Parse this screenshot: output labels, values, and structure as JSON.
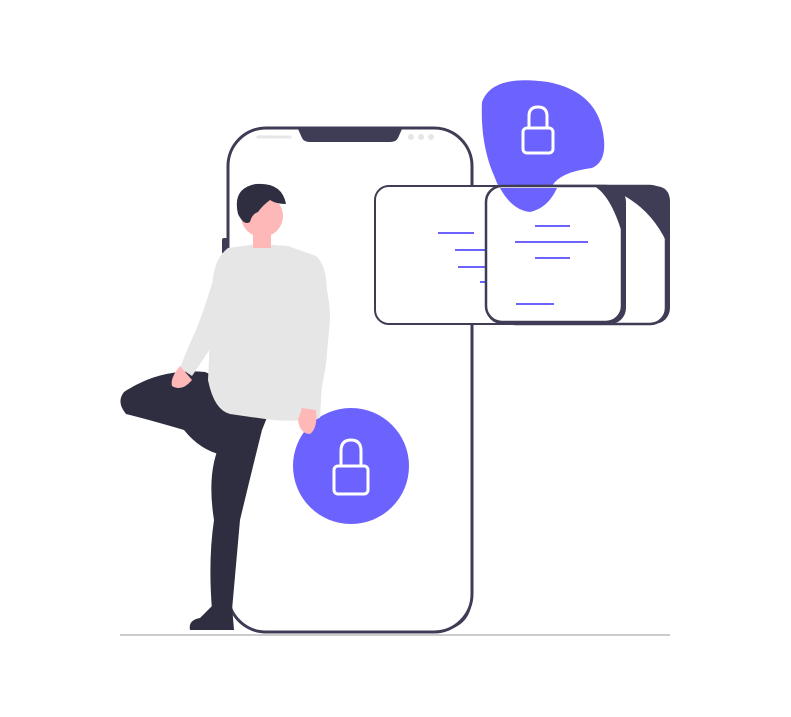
{
  "illustration": {
    "subject": "person-with-phone-and-locked-cards",
    "icons": [
      "lock-icon",
      "lock-icon"
    ],
    "colors": {
      "accent": "#6c63ff",
      "dark": "#3f3d56",
      "skin": "#ffb8b8",
      "hair": "#2f2e41",
      "shirt": "#e6e6e6",
      "ground": "#cccccc",
      "white": "#ffffff"
    }
  }
}
